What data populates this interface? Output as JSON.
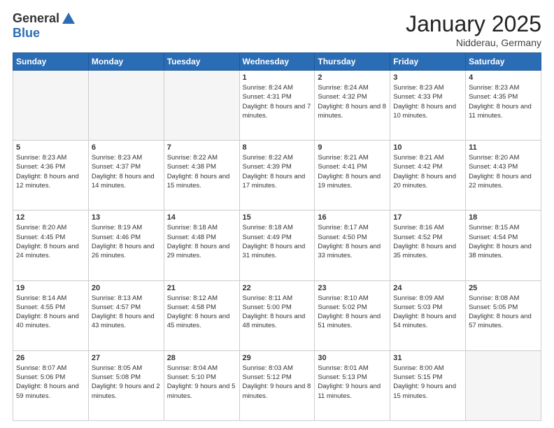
{
  "header": {
    "logo_general": "General",
    "logo_blue": "Blue",
    "month_title": "January 2025",
    "location": "Nidderau, Germany"
  },
  "weekdays": [
    "Sunday",
    "Monday",
    "Tuesday",
    "Wednesday",
    "Thursday",
    "Friday",
    "Saturday"
  ],
  "weeks": [
    [
      {
        "day": "",
        "empty": true
      },
      {
        "day": "",
        "empty": true
      },
      {
        "day": "",
        "empty": true
      },
      {
        "day": "1",
        "rise": "8:24 AM",
        "set": "4:31 PM",
        "daylight": "8 hours and 7 minutes."
      },
      {
        "day": "2",
        "rise": "8:24 AM",
        "set": "4:32 PM",
        "daylight": "8 hours and 8 minutes."
      },
      {
        "day": "3",
        "rise": "8:23 AM",
        "set": "4:33 PM",
        "daylight": "8 hours and 10 minutes."
      },
      {
        "day": "4",
        "rise": "8:23 AM",
        "set": "4:35 PM",
        "daylight": "8 hours and 11 minutes."
      }
    ],
    [
      {
        "day": "5",
        "rise": "8:23 AM",
        "set": "4:36 PM",
        "daylight": "8 hours and 12 minutes."
      },
      {
        "day": "6",
        "rise": "8:23 AM",
        "set": "4:37 PM",
        "daylight": "8 hours and 14 minutes."
      },
      {
        "day": "7",
        "rise": "8:22 AM",
        "set": "4:38 PM",
        "daylight": "8 hours and 15 minutes."
      },
      {
        "day": "8",
        "rise": "8:22 AM",
        "set": "4:39 PM",
        "daylight": "8 hours and 17 minutes."
      },
      {
        "day": "9",
        "rise": "8:21 AM",
        "set": "4:41 PM",
        "daylight": "8 hours and 19 minutes."
      },
      {
        "day": "10",
        "rise": "8:21 AM",
        "set": "4:42 PM",
        "daylight": "8 hours and 20 minutes."
      },
      {
        "day": "11",
        "rise": "8:20 AM",
        "set": "4:43 PM",
        "daylight": "8 hours and 22 minutes."
      }
    ],
    [
      {
        "day": "12",
        "rise": "8:20 AM",
        "set": "4:45 PM",
        "daylight": "8 hours and 24 minutes."
      },
      {
        "day": "13",
        "rise": "8:19 AM",
        "set": "4:46 PM",
        "daylight": "8 hours and 26 minutes."
      },
      {
        "day": "14",
        "rise": "8:18 AM",
        "set": "4:48 PM",
        "daylight": "8 hours and 29 minutes."
      },
      {
        "day": "15",
        "rise": "8:18 AM",
        "set": "4:49 PM",
        "daylight": "8 hours and 31 minutes."
      },
      {
        "day": "16",
        "rise": "8:17 AM",
        "set": "4:50 PM",
        "daylight": "8 hours and 33 minutes."
      },
      {
        "day": "17",
        "rise": "8:16 AM",
        "set": "4:52 PM",
        "daylight": "8 hours and 35 minutes."
      },
      {
        "day": "18",
        "rise": "8:15 AM",
        "set": "4:54 PM",
        "daylight": "8 hours and 38 minutes."
      }
    ],
    [
      {
        "day": "19",
        "rise": "8:14 AM",
        "set": "4:55 PM",
        "daylight": "8 hours and 40 minutes."
      },
      {
        "day": "20",
        "rise": "8:13 AM",
        "set": "4:57 PM",
        "daylight": "8 hours and 43 minutes."
      },
      {
        "day": "21",
        "rise": "8:12 AM",
        "set": "4:58 PM",
        "daylight": "8 hours and 45 minutes."
      },
      {
        "day": "22",
        "rise": "8:11 AM",
        "set": "5:00 PM",
        "daylight": "8 hours and 48 minutes."
      },
      {
        "day": "23",
        "rise": "8:10 AM",
        "set": "5:02 PM",
        "daylight": "8 hours and 51 minutes."
      },
      {
        "day": "24",
        "rise": "8:09 AM",
        "set": "5:03 PM",
        "daylight": "8 hours and 54 minutes."
      },
      {
        "day": "25",
        "rise": "8:08 AM",
        "set": "5:05 PM",
        "daylight": "8 hours and 57 minutes."
      }
    ],
    [
      {
        "day": "26",
        "rise": "8:07 AM",
        "set": "5:06 PM",
        "daylight": "8 hours and 59 minutes."
      },
      {
        "day": "27",
        "rise": "8:05 AM",
        "set": "5:08 PM",
        "daylight": "9 hours and 2 minutes."
      },
      {
        "day": "28",
        "rise": "8:04 AM",
        "set": "5:10 PM",
        "daylight": "9 hours and 5 minutes."
      },
      {
        "day": "29",
        "rise": "8:03 AM",
        "set": "5:12 PM",
        "daylight": "9 hours and 8 minutes."
      },
      {
        "day": "30",
        "rise": "8:01 AM",
        "set": "5:13 PM",
        "daylight": "9 hours and 11 minutes."
      },
      {
        "day": "31",
        "rise": "8:00 AM",
        "set": "5:15 PM",
        "daylight": "9 hours and 15 minutes."
      },
      {
        "day": "",
        "empty": true
      }
    ]
  ]
}
